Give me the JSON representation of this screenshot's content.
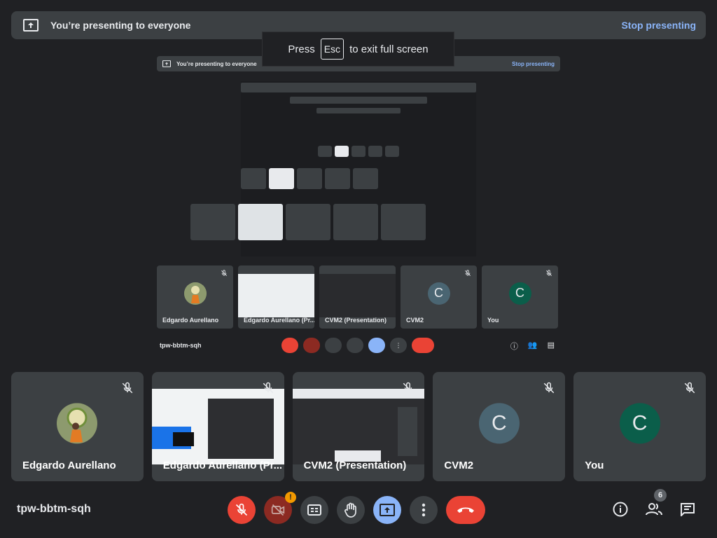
{
  "banner": {
    "text": "You’re presenting to everyone",
    "stop_label": "Stop presenting"
  },
  "toast": {
    "prefix": "Press",
    "key": "Esc",
    "suffix": "to exit full screen"
  },
  "participants": [
    {
      "name": "Edgardo Aurellano",
      "type": "photo"
    },
    {
      "name": "Edgardo Aurellano (Pr...",
      "type": "screen"
    },
    {
      "name": "CVM2 (Presentation)",
      "type": "screen"
    },
    {
      "name": "CVM2",
      "type": "initial",
      "initial": "C",
      "color": "#4a6572"
    },
    {
      "name": "You",
      "type": "initial",
      "initial": "C",
      "color": "#0b5e4a"
    }
  ],
  "meeting": {
    "code": "tpw-bbtm-sqh",
    "people_count": "6",
    "camera_alert": "!"
  },
  "colors": {
    "background": "#202124",
    "tile": "#3c4043",
    "accent": "#8ab4f8",
    "danger": "#ea4335"
  },
  "icons": {
    "mic": "mic-off-icon",
    "camera": "camera-off-icon",
    "captions": "captions-icon",
    "hand": "raise-hand-icon",
    "present": "present-screen-icon",
    "more": "more-vert-icon",
    "end": "call-end-icon",
    "info": "info-icon",
    "people": "people-icon",
    "chat": "chat-icon"
  }
}
